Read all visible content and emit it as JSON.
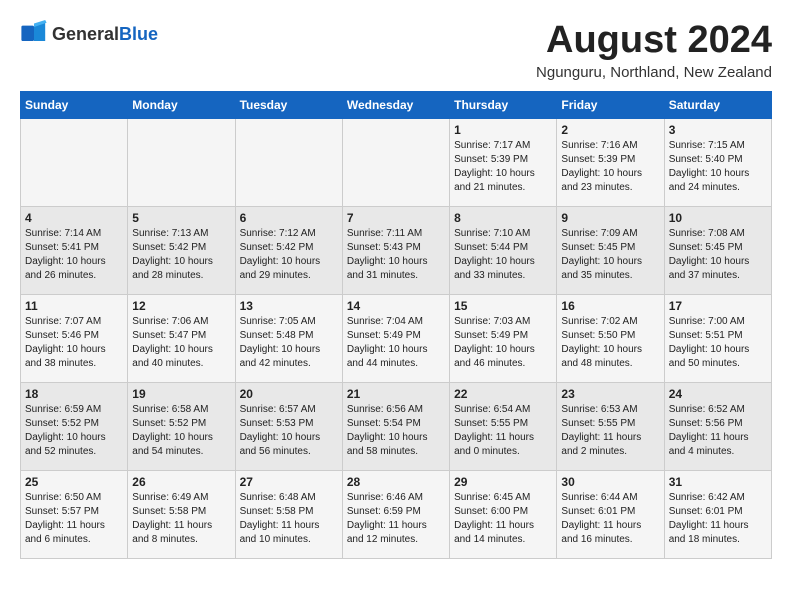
{
  "header": {
    "logo_general": "General",
    "logo_blue": "Blue",
    "title": "August 2024",
    "subtitle": "Ngunguru, Northland, New Zealand"
  },
  "days_of_week": [
    "Sunday",
    "Monday",
    "Tuesday",
    "Wednesday",
    "Thursday",
    "Friday",
    "Saturday"
  ],
  "weeks": [
    [
      {
        "day": "",
        "info": ""
      },
      {
        "day": "",
        "info": ""
      },
      {
        "day": "",
        "info": ""
      },
      {
        "day": "",
        "info": ""
      },
      {
        "day": "1",
        "info": "Sunrise: 7:17 AM\nSunset: 5:39 PM\nDaylight: 10 hours\nand 21 minutes."
      },
      {
        "day": "2",
        "info": "Sunrise: 7:16 AM\nSunset: 5:39 PM\nDaylight: 10 hours\nand 23 minutes."
      },
      {
        "day": "3",
        "info": "Sunrise: 7:15 AM\nSunset: 5:40 PM\nDaylight: 10 hours\nand 24 minutes."
      }
    ],
    [
      {
        "day": "4",
        "info": "Sunrise: 7:14 AM\nSunset: 5:41 PM\nDaylight: 10 hours\nand 26 minutes."
      },
      {
        "day": "5",
        "info": "Sunrise: 7:13 AM\nSunset: 5:42 PM\nDaylight: 10 hours\nand 28 minutes."
      },
      {
        "day": "6",
        "info": "Sunrise: 7:12 AM\nSunset: 5:42 PM\nDaylight: 10 hours\nand 29 minutes."
      },
      {
        "day": "7",
        "info": "Sunrise: 7:11 AM\nSunset: 5:43 PM\nDaylight: 10 hours\nand 31 minutes."
      },
      {
        "day": "8",
        "info": "Sunrise: 7:10 AM\nSunset: 5:44 PM\nDaylight: 10 hours\nand 33 minutes."
      },
      {
        "day": "9",
        "info": "Sunrise: 7:09 AM\nSunset: 5:45 PM\nDaylight: 10 hours\nand 35 minutes."
      },
      {
        "day": "10",
        "info": "Sunrise: 7:08 AM\nSunset: 5:45 PM\nDaylight: 10 hours\nand 37 minutes."
      }
    ],
    [
      {
        "day": "11",
        "info": "Sunrise: 7:07 AM\nSunset: 5:46 PM\nDaylight: 10 hours\nand 38 minutes."
      },
      {
        "day": "12",
        "info": "Sunrise: 7:06 AM\nSunset: 5:47 PM\nDaylight: 10 hours\nand 40 minutes."
      },
      {
        "day": "13",
        "info": "Sunrise: 7:05 AM\nSunset: 5:48 PM\nDaylight: 10 hours\nand 42 minutes."
      },
      {
        "day": "14",
        "info": "Sunrise: 7:04 AM\nSunset: 5:49 PM\nDaylight: 10 hours\nand 44 minutes."
      },
      {
        "day": "15",
        "info": "Sunrise: 7:03 AM\nSunset: 5:49 PM\nDaylight: 10 hours\nand 46 minutes."
      },
      {
        "day": "16",
        "info": "Sunrise: 7:02 AM\nSunset: 5:50 PM\nDaylight: 10 hours\nand 48 minutes."
      },
      {
        "day": "17",
        "info": "Sunrise: 7:00 AM\nSunset: 5:51 PM\nDaylight: 10 hours\nand 50 minutes."
      }
    ],
    [
      {
        "day": "18",
        "info": "Sunrise: 6:59 AM\nSunset: 5:52 PM\nDaylight: 10 hours\nand 52 minutes."
      },
      {
        "day": "19",
        "info": "Sunrise: 6:58 AM\nSunset: 5:52 PM\nDaylight: 10 hours\nand 54 minutes."
      },
      {
        "day": "20",
        "info": "Sunrise: 6:57 AM\nSunset: 5:53 PM\nDaylight: 10 hours\nand 56 minutes."
      },
      {
        "day": "21",
        "info": "Sunrise: 6:56 AM\nSunset: 5:54 PM\nDaylight: 10 hours\nand 58 minutes."
      },
      {
        "day": "22",
        "info": "Sunrise: 6:54 AM\nSunset: 5:55 PM\nDaylight: 11 hours\nand 0 minutes."
      },
      {
        "day": "23",
        "info": "Sunrise: 6:53 AM\nSunset: 5:55 PM\nDaylight: 11 hours\nand 2 minutes."
      },
      {
        "day": "24",
        "info": "Sunrise: 6:52 AM\nSunset: 5:56 PM\nDaylight: 11 hours\nand 4 minutes."
      }
    ],
    [
      {
        "day": "25",
        "info": "Sunrise: 6:50 AM\nSunset: 5:57 PM\nDaylight: 11 hours\nand 6 minutes."
      },
      {
        "day": "26",
        "info": "Sunrise: 6:49 AM\nSunset: 5:58 PM\nDaylight: 11 hours\nand 8 minutes."
      },
      {
        "day": "27",
        "info": "Sunrise: 6:48 AM\nSunset: 5:58 PM\nDaylight: 11 hours\nand 10 minutes."
      },
      {
        "day": "28",
        "info": "Sunrise: 6:46 AM\nSunset: 6:59 PM\nDaylight: 11 hours\nand 12 minutes."
      },
      {
        "day": "29",
        "info": "Sunrise: 6:45 AM\nSunset: 6:00 PM\nDaylight: 11 hours\nand 14 minutes."
      },
      {
        "day": "30",
        "info": "Sunrise: 6:44 AM\nSunset: 6:01 PM\nDaylight: 11 hours\nand 16 minutes."
      },
      {
        "day": "31",
        "info": "Sunrise: 6:42 AM\nSunset: 6:01 PM\nDaylight: 11 hours\nand 18 minutes."
      }
    ]
  ]
}
